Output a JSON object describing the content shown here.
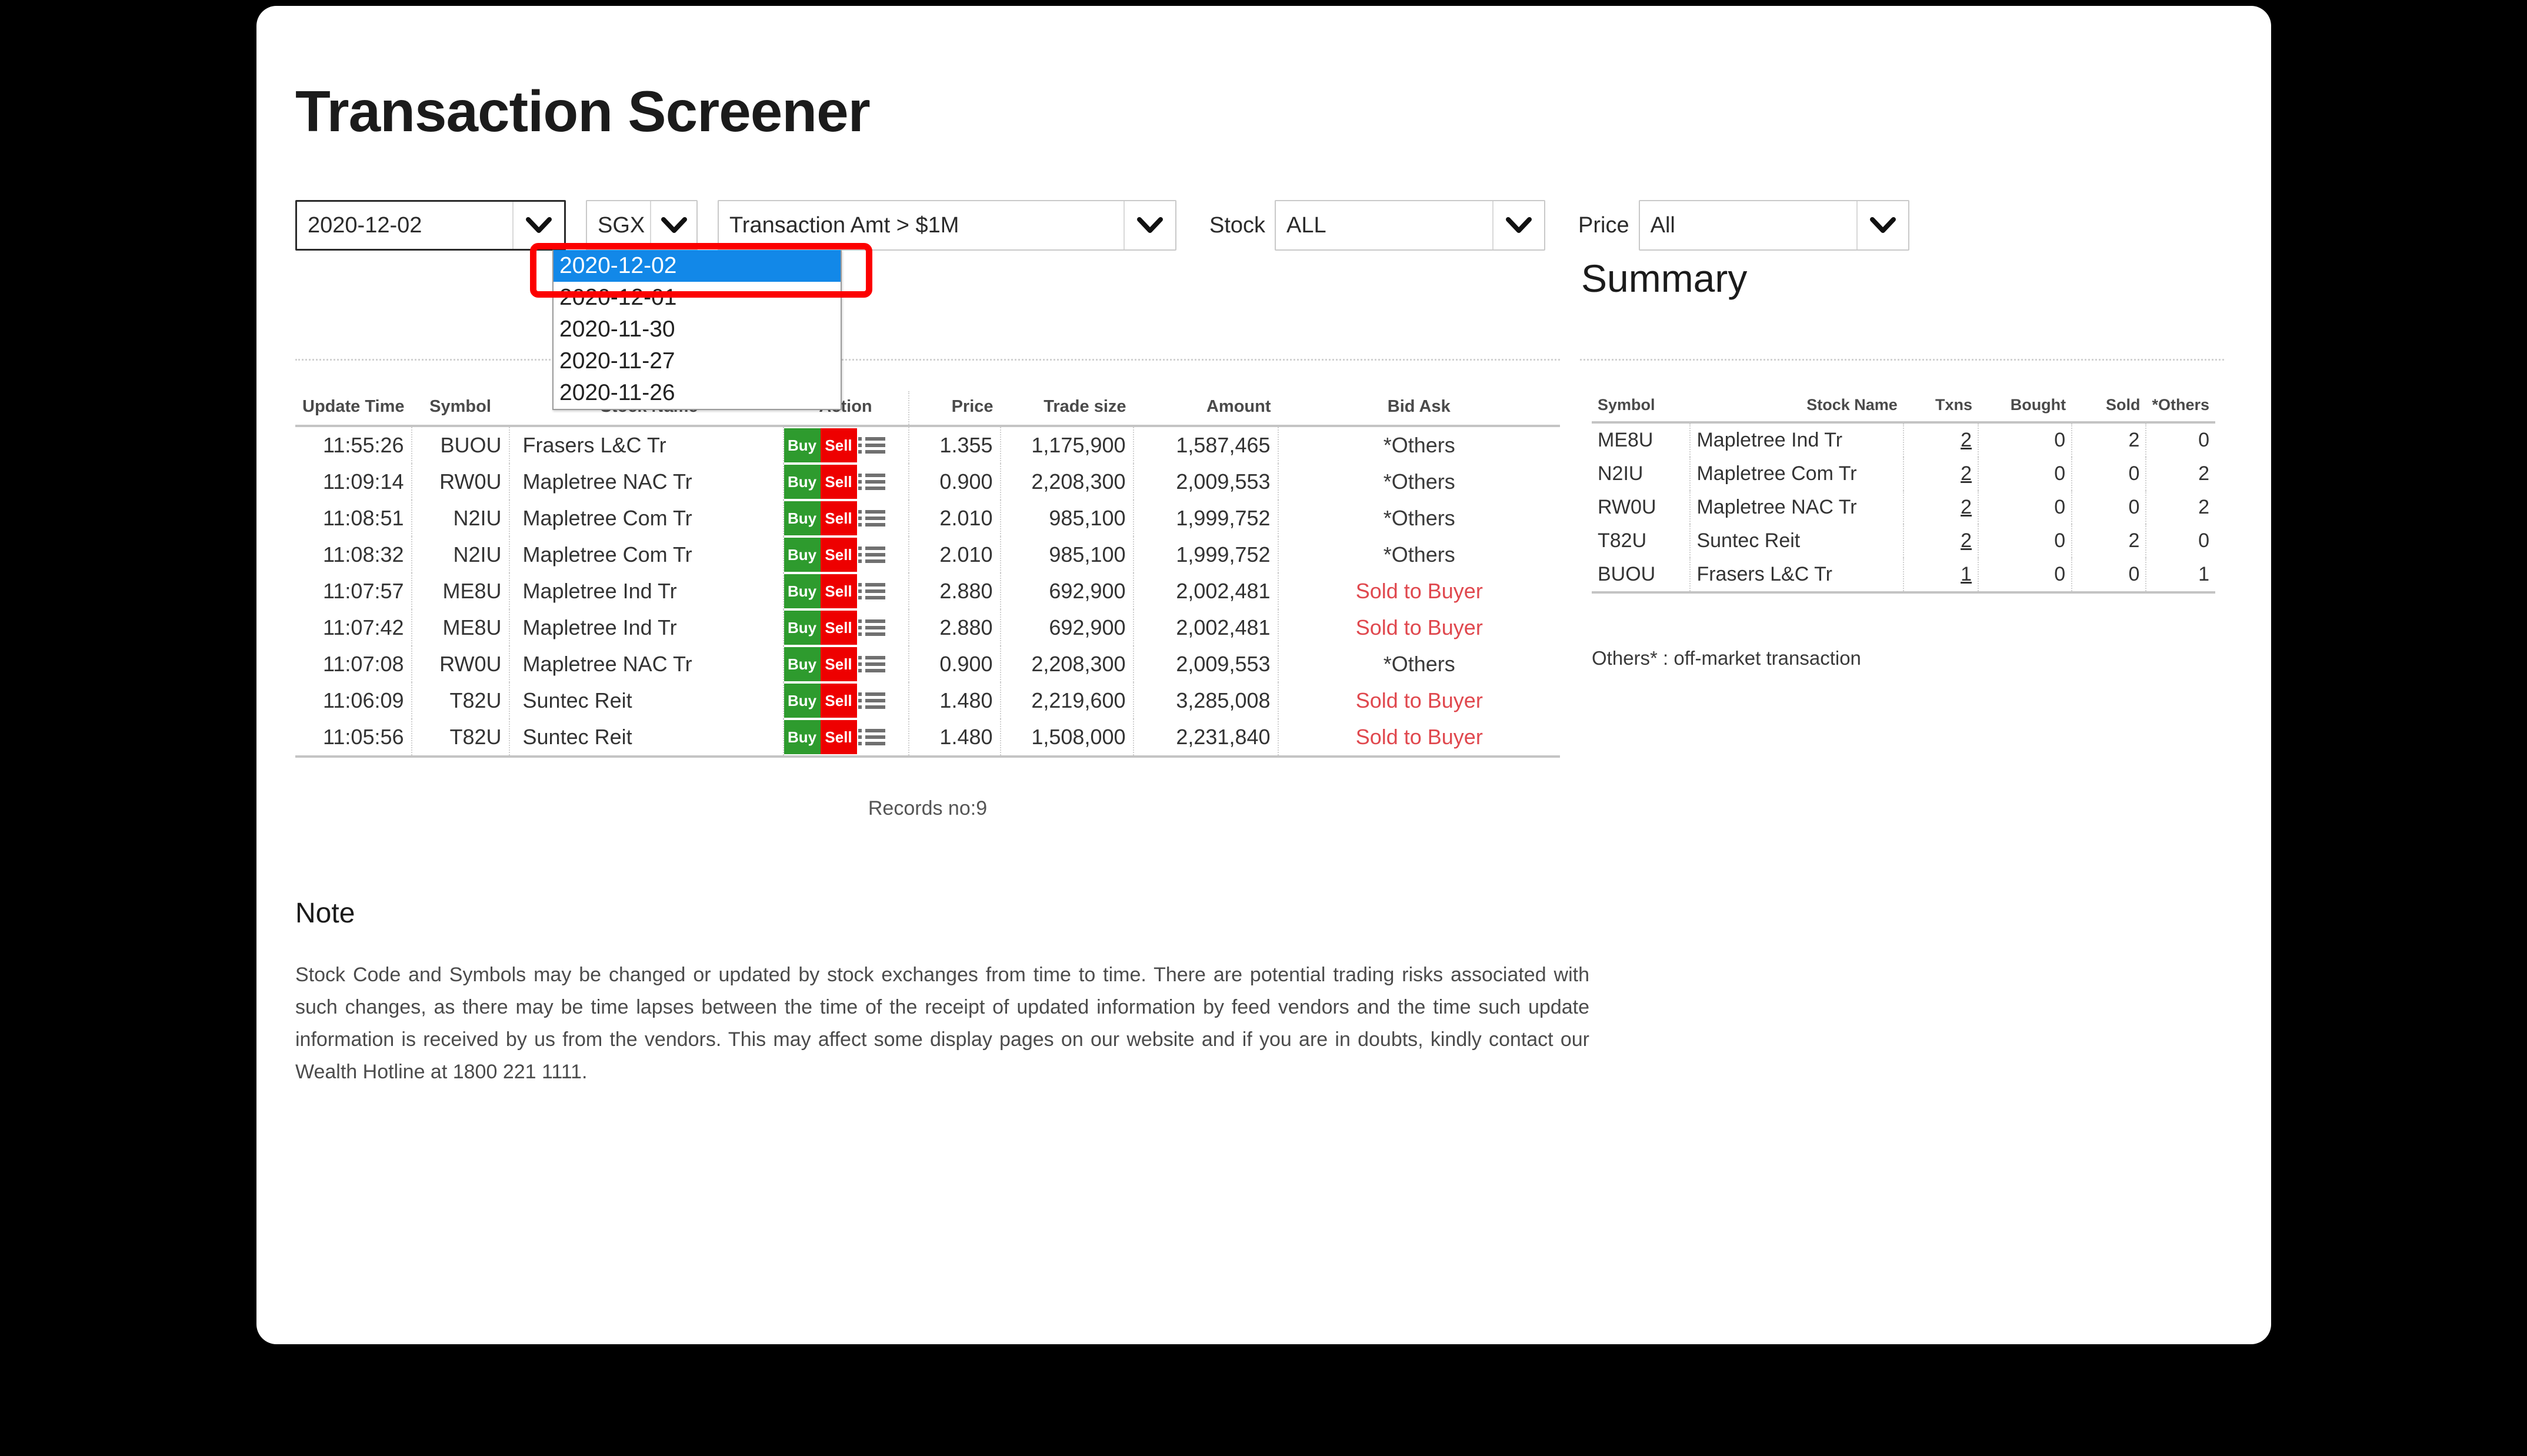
{
  "page": {
    "title": "Transaction Screener"
  },
  "filters": {
    "date": {
      "value": "2020-12-02",
      "options": [
        "2020-12-02",
        "2020-12-01",
        "2020-11-30",
        "2020-11-27",
        "2020-11-26"
      ],
      "selected_index": 0
    },
    "market": {
      "value": "SGX"
    },
    "amount": {
      "value": "Transaction Amt > $1M"
    },
    "stock": {
      "label": "Stock",
      "value": "ALL"
    },
    "price": {
      "label": "Price",
      "value": "All"
    }
  },
  "transactions": {
    "headers": [
      "Update Time",
      "Symbol",
      "Stock Name",
      "Action",
      "Price",
      "Trade size",
      "Amount",
      "Bid Ask"
    ],
    "action_labels": {
      "buy": "Buy",
      "sell": "Sell"
    },
    "rows": [
      {
        "time": "11:55:26",
        "symbol": "BUOU",
        "name": "Frasers L&C Tr",
        "price": "1.355",
        "size": "1,175,900",
        "amount": "1,587,465",
        "bidask": "*Others",
        "bidask_kind": "others"
      },
      {
        "time": "11:09:14",
        "symbol": "RW0U",
        "name": "Mapletree NAC Tr",
        "price": "0.900",
        "size": "2,208,300",
        "amount": "2,009,553",
        "bidask": "*Others",
        "bidask_kind": "others"
      },
      {
        "time": "11:08:51",
        "symbol": "N2IU",
        "name": "Mapletree Com Tr",
        "price": "2.010",
        "size": "985,100",
        "amount": "1,999,752",
        "bidask": "*Others",
        "bidask_kind": "others"
      },
      {
        "time": "11:08:32",
        "symbol": "N2IU",
        "name": "Mapletree Com Tr",
        "price": "2.010",
        "size": "985,100",
        "amount": "1,999,752",
        "bidask": "*Others",
        "bidask_kind": "others"
      },
      {
        "time": "11:07:57",
        "symbol": "ME8U",
        "name": "Mapletree Ind Tr",
        "price": "2.880",
        "size": "692,900",
        "amount": "2,002,481",
        "bidask": "Sold to Buyer",
        "bidask_kind": "sold"
      },
      {
        "time": "11:07:42",
        "symbol": "ME8U",
        "name": "Mapletree Ind Tr",
        "price": "2.880",
        "size": "692,900",
        "amount": "2,002,481",
        "bidask": "Sold to Buyer",
        "bidask_kind": "sold"
      },
      {
        "time": "11:07:08",
        "symbol": "RW0U",
        "name": "Mapletree NAC Tr",
        "price": "0.900",
        "size": "2,208,300",
        "amount": "2,009,553",
        "bidask": "*Others",
        "bidask_kind": "others"
      },
      {
        "time": "11:06:09",
        "symbol": "T82U",
        "name": "Suntec Reit",
        "price": "1.480",
        "size": "2,219,600",
        "amount": "3,285,008",
        "bidask": "Sold to Buyer",
        "bidask_kind": "sold"
      },
      {
        "time": "11:05:56",
        "symbol": "T82U",
        "name": "Suntec Reit",
        "price": "1.480",
        "size": "1,508,000",
        "amount": "2,231,840",
        "bidask": "Sold to Buyer",
        "bidask_kind": "sold"
      }
    ],
    "records_text": "Records no:9"
  },
  "summary": {
    "title": "Summary",
    "headers": [
      "Symbol",
      "Stock Name",
      "Txns",
      "Bought",
      "Sold",
      "*Others"
    ],
    "rows": [
      {
        "symbol": "ME8U",
        "name": "Mapletree Ind Tr",
        "txns": "2",
        "bought": "0",
        "sold": "2",
        "others": "0"
      },
      {
        "symbol": "N2IU",
        "name": "Mapletree Com Tr",
        "txns": "2",
        "bought": "0",
        "sold": "0",
        "others": "2"
      },
      {
        "symbol": "RW0U",
        "name": "Mapletree NAC Tr",
        "txns": "2",
        "bought": "0",
        "sold": "0",
        "others": "2"
      },
      {
        "symbol": "T82U",
        "name": "Suntec Reit",
        "txns": "2",
        "bought": "0",
        "sold": "2",
        "others": "0"
      },
      {
        "symbol": "BUOU",
        "name": "Frasers L&C Tr",
        "txns": "1",
        "bought": "0",
        "sold": "0",
        "others": "1"
      }
    ],
    "footnote": "Others* : off-market transaction"
  },
  "note": {
    "title": "Note",
    "body": "Stock Code and Symbols may be changed or updated by stock exchanges from time to time. There are potential trading risks associated with such changes, as there may be time lapses between the time of the receipt of updated information by feed vendors and the time such update information is received by us from the vendors. This may affect some display pages on our website and if you are in doubts, kindly contact our Wealth Hotline at 1800 221 1111."
  },
  "colors": {
    "buy": "#2e9b2e",
    "sell": "#ee0000",
    "sold_text": "#e0484e",
    "bought_header": "#3333cc",
    "sold_header": "#e04040",
    "highlight": "#1288e8",
    "annotation": "#fc0000"
  }
}
